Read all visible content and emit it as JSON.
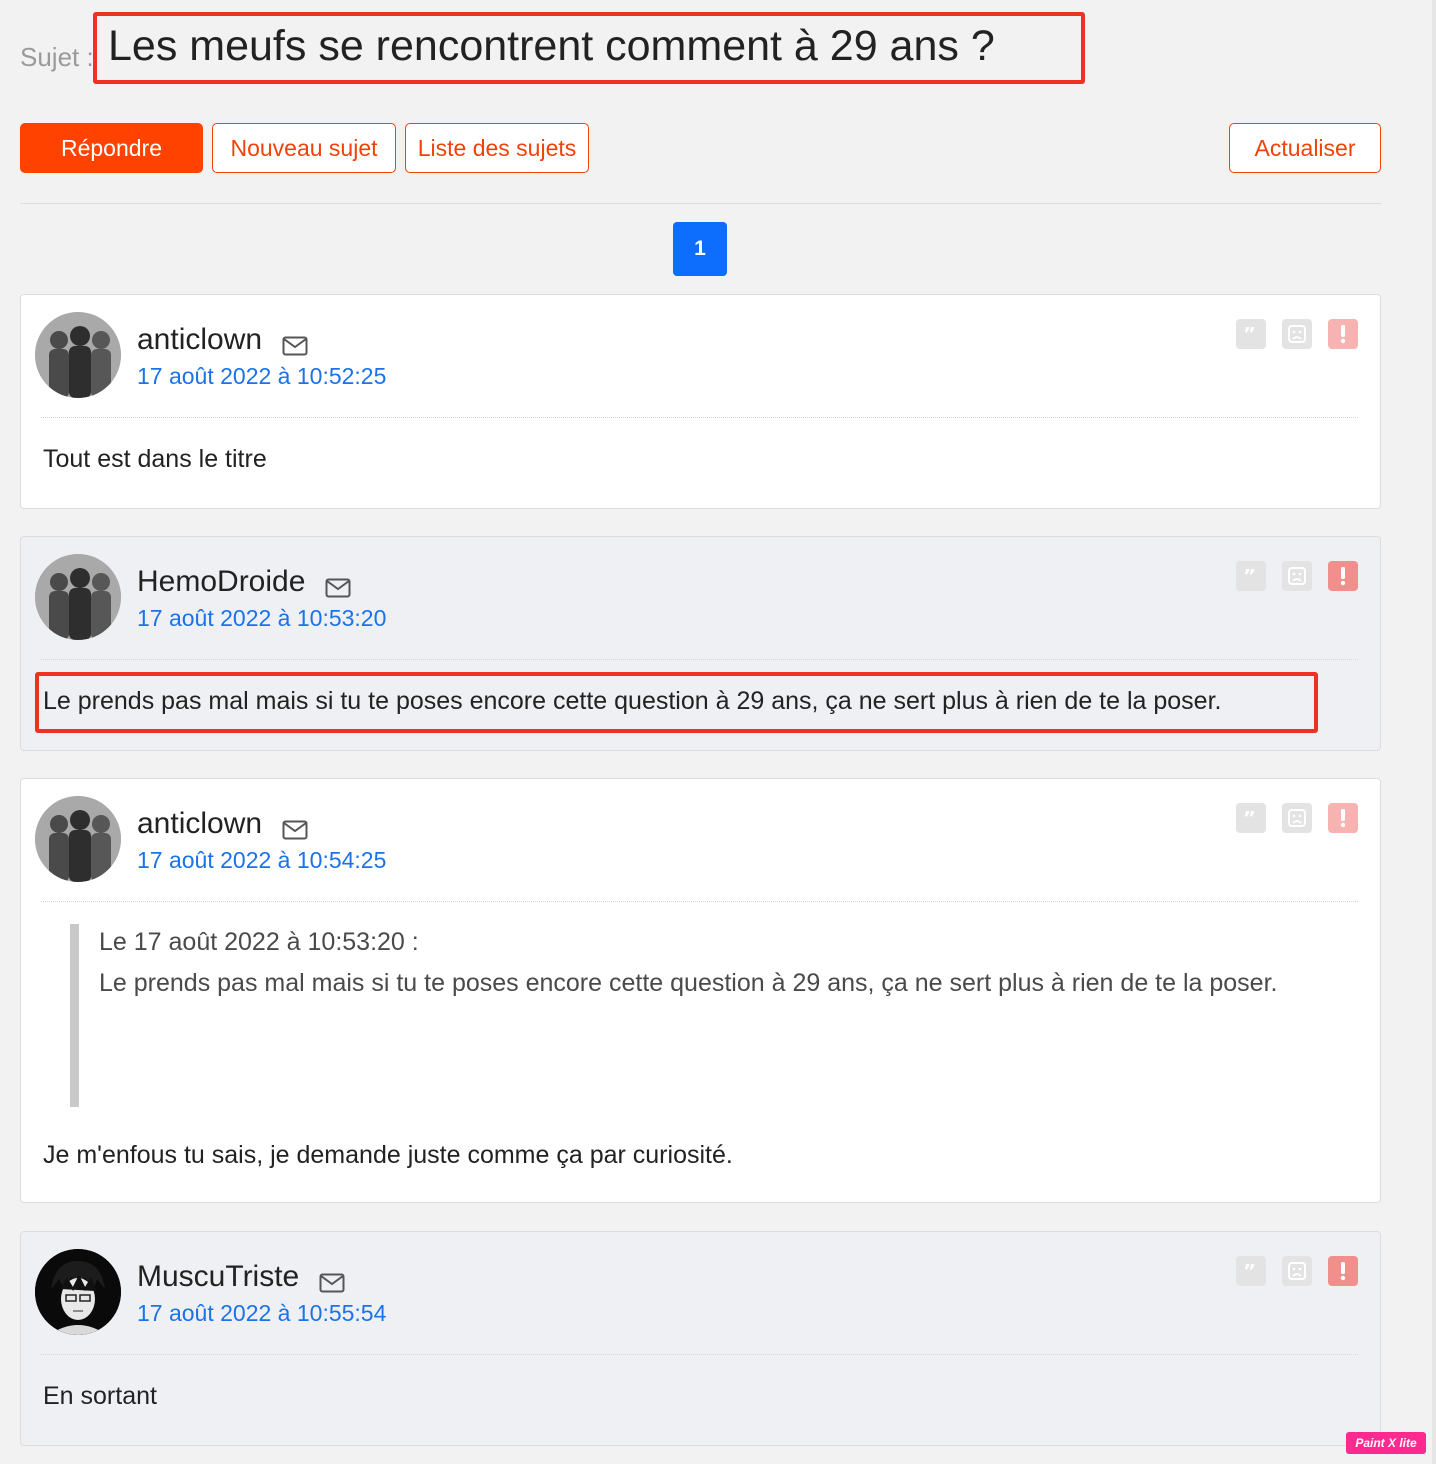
{
  "topic": {
    "prefix": "Sujet :",
    "title": "Les meufs se rencontrent comment à 29 ans ?"
  },
  "toolbar": {
    "reply": "Répondre",
    "new_topic": "Nouveau sujet",
    "topic_list": "Liste des sujets",
    "refresh": "Actualiser"
  },
  "pagination": {
    "current": "1"
  },
  "posts": [
    {
      "author": "anticlown",
      "date": "17 août 2022 à 10:52:25",
      "text": "Tout est dans le titre"
    },
    {
      "author": "HemoDroide",
      "date": "17 août 2022 à 10:53:20",
      "text": "Le prends pas mal mais si tu te poses encore cette question à 29 ans, ça ne sert plus à rien de te la poser."
    },
    {
      "author": "anticlown",
      "date": "17 août 2022 à 10:54:25",
      "quote_header": "Le 17 août 2022 à 10:53:20 :",
      "quote_text": "Le prends pas mal mais si tu te poses encore cette question à 29 ans, ça ne sert plus à rien de te la poser.",
      "text": "Je m'enfous tu sais, je demande juste comme ça par curiosité."
    },
    {
      "author": "MuscuTriste",
      "date": "17 août 2022 à 10:55:54",
      "text": "En sortant"
    }
  ],
  "icons": {
    "quote": "quote-icon",
    "sad": "sad-face-icon",
    "report": "exclamation-icon",
    "mail": "mail-icon"
  },
  "colors": {
    "accent": "#ff4200",
    "link": "#1a73e8",
    "page_active": "#0d6efd",
    "highlight": "#ea3323"
  },
  "watermark": "Paint X lite"
}
